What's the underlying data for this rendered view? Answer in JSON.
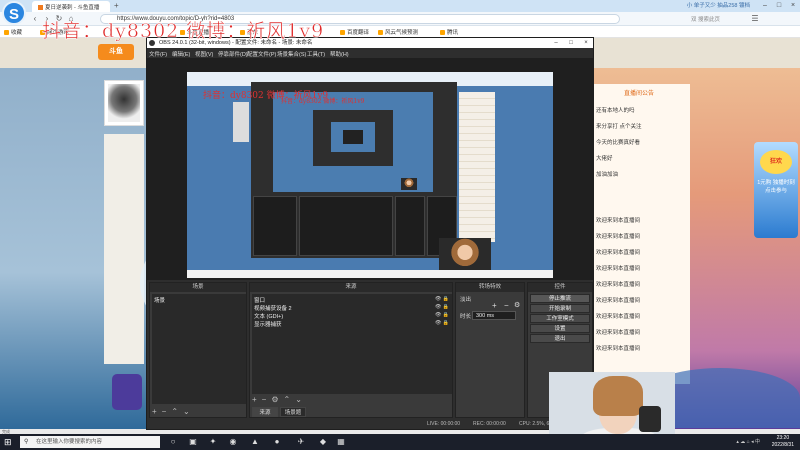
{
  "browser": {
    "logo": "S",
    "active_tab": "夏日逆袭刺 - 斗鱼直播",
    "new_tab": "+",
    "title_right": "小 单子又少 抽品258 镀档",
    "url": "https://www.douyu.com/topic/D-yh?rid=4803",
    "url_right": "双 搜索此页",
    "bookmarks": [
      "收藏",
      "网页游戏",
      "斗鱼直播",
      "京东",
      "百度翻译",
      "风云气候预测",
      "腾讯"
    ]
  },
  "watermark": {
    "main": "抖音：dy8302   微博：祈风1v9",
    "preview": "抖音：dy8302   微博：祈风1v9",
    "preview_small": "抖音：dy8302 微博：祈风1v9"
  },
  "page": {
    "site_logo": "斗鱼",
    "right_title": "直播间公告",
    "promo_text": "1元购 独播时刻 点击参与",
    "promo_circle": "狂欢",
    "chat": [
      {
        "user": "",
        "text": "还有本地人的吗"
      },
      {
        "user": "",
        "text": "来分享打 点个关注"
      },
      {
        "user": "",
        "text": "今天的比赛真好看"
      },
      {
        "user": "",
        "text": "大佬好"
      },
      {
        "user": "",
        "text": "加油加油"
      },
      {
        "user": "",
        "text": "欢迎来到本直播间"
      },
      {
        "user": "",
        "text": "欢迎来到本直播间"
      },
      {
        "user": "",
        "text": "欢迎来到本直播间"
      },
      {
        "user": "",
        "text": "欢迎来到本直播间"
      },
      {
        "user": "",
        "text": "欢迎来到本直播间"
      },
      {
        "user": "",
        "text": "欢迎来到本直播间"
      },
      {
        "user": "",
        "text": "欢迎来到本直播间"
      },
      {
        "user": "",
        "text": "欢迎来到本直播间"
      },
      {
        "user": "",
        "text": "欢迎来到本直播间"
      }
    ]
  },
  "obs": {
    "title": "OBS 24.0.1 (32-bit, windows) - 配置文件: 未命名 - 场景: 未命名",
    "menus": [
      "文件(F)",
      "编辑(E)",
      "视图(V)",
      "停靠部件(D)",
      "配置文件(P)",
      "场景集合(S)",
      "工具(T)",
      "帮助(H)"
    ],
    "docks": {
      "scenes": {
        "title": "场景",
        "items": [
          "场景"
        ]
      },
      "sources": {
        "title": "来源",
        "items": [
          "窗口",
          "视频捕获设备 2",
          "文本 (GDI+)",
          "显示器捕获"
        ],
        "tabs": [
          "来源",
          "场景题"
        ]
      },
      "mixer": {
        "title": "转场特效",
        "label1": "淡出",
        "label2": "时长",
        "duration": "300 ms"
      },
      "controls": {
        "title": "控件",
        "buttons": [
          "停止推流",
          "开始录制",
          "工作室模式",
          "设置",
          "退出"
        ]
      }
    },
    "status": {
      "live": "LIVE: 00:00:00",
      "rec": "REC: 00:00:00",
      "cpu": "CPU: 2.5%, 60.00 fps"
    }
  },
  "taskbar": {
    "search_placeholder": "在这里输入你要搜索的内容",
    "time": "23:20",
    "date": "2022/8/31",
    "statusline": "完成"
  }
}
